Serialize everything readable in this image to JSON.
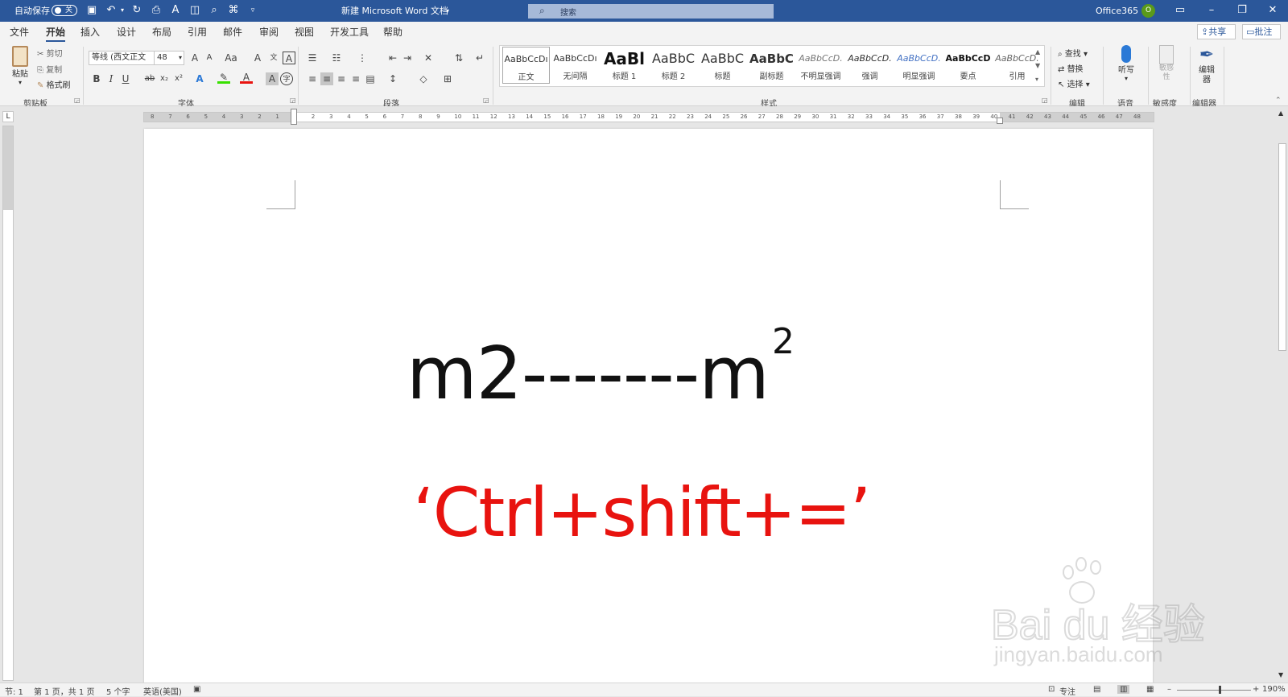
{
  "titlebar": {
    "autosave_label": "自动保存",
    "autosave_state": "关",
    "doc_title": "新建 Microsoft Word 文档",
    "search_placeholder": "搜索",
    "account_name": "Office365",
    "account_initial": "O"
  },
  "tabs": [
    "文件",
    "开始",
    "插入",
    "设计",
    "布局",
    "引用",
    "邮件",
    "审阅",
    "视图",
    "开发工具",
    "帮助"
  ],
  "active_tab": "开始",
  "share_label": "共享",
  "comment_label": "批注",
  "clipboard": {
    "paste": "粘贴",
    "cut": "剪切",
    "copy": "复制",
    "format_painter": "格式刷",
    "label": "剪贴板"
  },
  "font": {
    "name": "等线 (西文正文",
    "size": "48",
    "label": "字体",
    "case": "Aa",
    "bold": "B",
    "italic": "I",
    "underline": "U",
    "strike": "ab",
    "subscript": "x₂",
    "superscript": "x²"
  },
  "paragraph": {
    "label": "段落"
  },
  "styles": {
    "label": "样式",
    "items": [
      {
        "preview": "AaBbCcDı",
        "name": "正文"
      },
      {
        "preview": "AaBbCcDı",
        "name": "无间隔"
      },
      {
        "preview": "AaBl",
        "name": "标题 1"
      },
      {
        "preview": "AaBbC",
        "name": "标题 2"
      },
      {
        "preview": "AaBbC",
        "name": "标题"
      },
      {
        "preview": "AaBbC",
        "name": "副标题"
      },
      {
        "preview": "AaBbCcD.",
        "name": "不明显强调"
      },
      {
        "preview": "AaBbCcD.",
        "name": "强调"
      },
      {
        "preview": "AaBbCcD.",
        "name": "明显强调"
      },
      {
        "preview": "AaBbCcD",
        "name": "要点"
      },
      {
        "preview": "AaBbCcD.",
        "name": "引用"
      }
    ]
  },
  "editing": {
    "find": "查找",
    "replace": "替换",
    "select": "选择",
    "label": "编辑"
  },
  "voice": {
    "dictate": "听写",
    "label": "语音"
  },
  "sensitivity": {
    "btn": "敏感性",
    "label": "敏感度"
  },
  "editor": {
    "btn": "编辑器",
    "label": "编辑器"
  },
  "ruler_numbers": [
    "8",
    "7",
    "6",
    "5",
    "4",
    "3",
    "2",
    "1",
    "1",
    "2",
    "3",
    "4",
    "5",
    "6",
    "7",
    "8",
    "9",
    "10",
    "11",
    "12",
    "13",
    "14",
    "15",
    "16",
    "17",
    "18",
    "19",
    "20",
    "21",
    "22",
    "23",
    "24",
    "25",
    "26",
    "27",
    "28",
    "29",
    "30",
    "31",
    "32",
    "33",
    "34",
    "35",
    "36",
    "37",
    "38",
    "39",
    "40",
    "41",
    "42",
    "43",
    "44",
    "45",
    "46",
    "47",
    "48"
  ],
  "document": {
    "line1_main": "m2-------m",
    "line1_sup": "2",
    "line2": "‘Ctrl+shift+=’",
    "line2_color": "#e8130f"
  },
  "watermark": {
    "logo": "Bai du 经验",
    "url": "jingyan.baidu.com"
  },
  "status": {
    "section": "节: 1",
    "page": "第 1 页，共 1 页",
    "words": "5 个字",
    "language": "英语(美国)",
    "focus": "专注",
    "zoom": "190%"
  },
  "colors": {
    "titlebar": "#2b579a",
    "ribbon": "#f3f3f3",
    "red_text": "#e8130f"
  }
}
